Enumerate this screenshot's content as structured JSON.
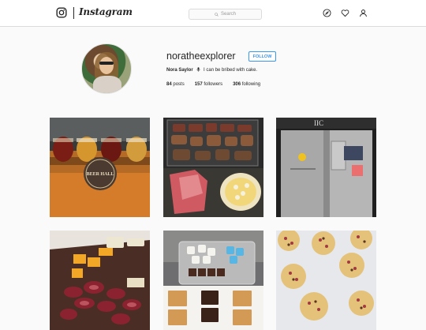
{
  "header": {
    "wordmark": "Instagram",
    "search_placeholder": "Search",
    "icons": [
      "instagram-glyph-icon",
      "compass-icon",
      "heart-icon",
      "person-icon"
    ]
  },
  "profile": {
    "username": "noratheexplorer",
    "follow_label": "FOLLOW",
    "full_name": "Nora Saylor",
    "bio": "I can be bribed with cake.",
    "stats": {
      "posts": "84",
      "posts_label": "posts",
      "followers": "157",
      "followers_label": "followers",
      "following": "306",
      "following_label": "following"
    }
  },
  "posts": [
    {
      "subject": "beer flight",
      "caption": "BEER HALL"
    },
    {
      "subject": "grilled meats"
    },
    {
      "subject": "hospital doors",
      "caption": "IIC"
    },
    {
      "subject": "cheese and meat board"
    },
    {
      "subject": "smores ingredients"
    },
    {
      "subject": "cookies"
    }
  ],
  "colors": {
    "link_blue": "#3897f0",
    "border": "#dbdbdb",
    "background": "#fafafa",
    "text": "#262626"
  }
}
